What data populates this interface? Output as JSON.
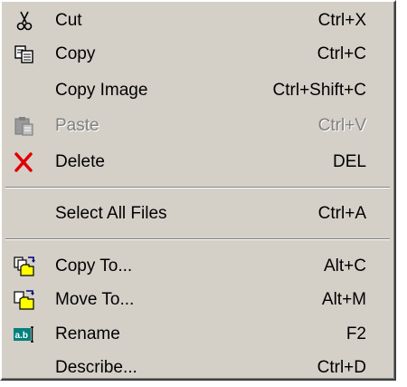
{
  "menu": {
    "items": [
      {
        "label": "Cut",
        "shortcut": "Ctrl+X",
        "icon": "scissors-icon",
        "enabled": true
      },
      {
        "label": "Copy",
        "shortcut": "Ctrl+C",
        "icon": "copy-icon",
        "enabled": true
      },
      {
        "label": "Copy Image",
        "shortcut": "Ctrl+Shift+C",
        "icon": "",
        "enabled": true
      },
      {
        "label": "Paste",
        "shortcut": "Ctrl+V",
        "icon": "paste-icon",
        "enabled": false
      },
      {
        "label": "Delete",
        "shortcut": "DEL",
        "icon": "delete-x-icon",
        "enabled": true
      },
      {
        "label": "Select All Files",
        "shortcut": "Ctrl+A",
        "icon": "",
        "enabled": true
      },
      {
        "label": "Copy To...",
        "shortcut": "Alt+C",
        "icon": "copy-to-folder-icon",
        "enabled": true
      },
      {
        "label": "Move To...",
        "shortcut": "Alt+M",
        "icon": "move-to-folder-icon",
        "enabled": true
      },
      {
        "label": "Rename",
        "shortcut": "F2",
        "icon": "rename-icon",
        "enabled": true
      },
      {
        "label": "Describe...",
        "shortcut": "Ctrl+D",
        "icon": "",
        "enabled": true
      }
    ]
  },
  "colors": {
    "menu_face": "#d4d0c8",
    "disabled_text": "#808080",
    "delete_red": "#e00000",
    "folder_yellow": "#ffff00",
    "rename_teal": "#008080"
  }
}
